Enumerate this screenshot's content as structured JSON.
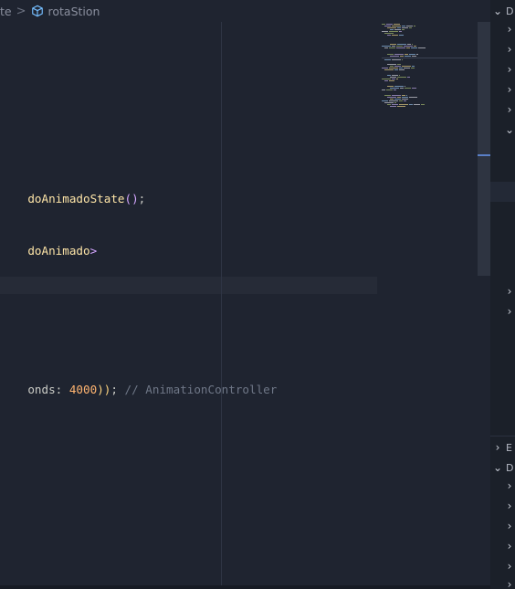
{
  "breadcrumb": {
    "parent_label": "te",
    "separator": ">",
    "symbol_icon": "cube-icon",
    "current_label": "rotaStion"
  },
  "code": {
    "line1": {
      "identifier": "doAnimadoState",
      "parens": "()",
      "end": ";"
    },
    "line2": {
      "identifier": "doAnimado",
      "close": ">"
    },
    "line3": {
      "param": "onds: ",
      "value": "4000",
      "close_parens": "))",
      "end": "; ",
      "comment": "// AnimationController"
    }
  },
  "side_panel": {
    "header_top": "D",
    "section_e": "E",
    "section_d": "D",
    "chevron_right": "›",
    "chevron_down": "⌄"
  },
  "colors": {
    "editor_bg": "#1f2430",
    "function": "#ffe6a8",
    "bracket": "#d4a6ff",
    "number": "#ffb470",
    "comment": "#6f7787",
    "accent": "#5a7fc7"
  }
}
